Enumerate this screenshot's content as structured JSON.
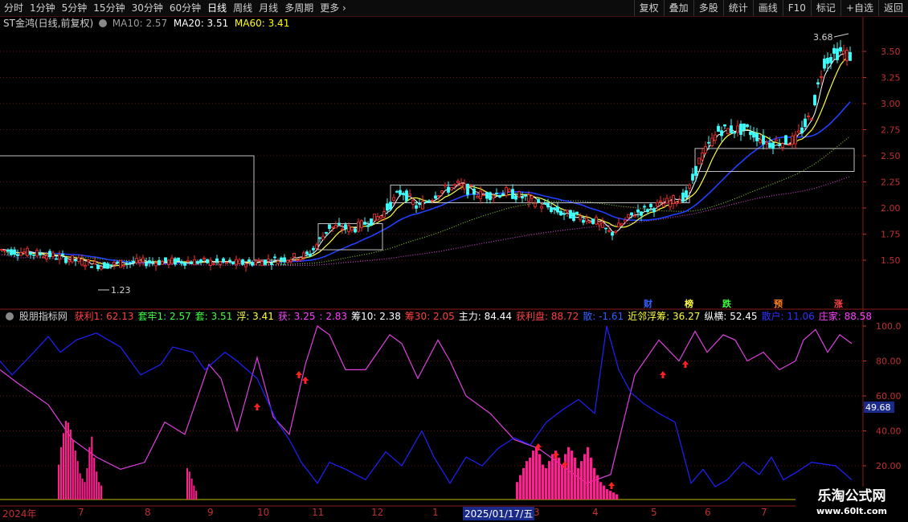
{
  "toolbar": {
    "periods": [
      "分时",
      "1分钟",
      "5分钟",
      "15分钟",
      "30分钟",
      "60分钟",
      "日线",
      "周线",
      "月线",
      "多周期",
      "更多"
    ],
    "active_period": "日线",
    "tools": [
      "复权",
      "叠加",
      "多股",
      "统计",
      "画线",
      "F10",
      "标记",
      "+自选",
      "返回"
    ]
  },
  "main_panel": {
    "stock": "ST金鸿(日线,前复权)",
    "ma10": {
      "label": "MA10: 2.57",
      "color": "#9c9c9c"
    },
    "ma20": {
      "label": "MA20: 3.51",
      "color": "#ffffff"
    },
    "ma60": {
      "label": "MA60: 3.41",
      "color": "#ffff00"
    },
    "high_label": "3.68",
    "low_label": "1.23",
    "yticks": [
      "3.50",
      "3.25",
      "3.00",
      "2.75",
      "2.50",
      "2.25",
      "2.00",
      "1.75",
      "1.50"
    ],
    "markers": [
      {
        "text": "财",
        "color": "#3060ff"
      },
      {
        "text": "榜",
        "color": "#ffff40"
      },
      {
        "text": "跌",
        "color": "#40ff40"
      },
      {
        "text": "预",
        "color": "#ff8020"
      },
      {
        "text": "涨",
        "color": "#ff4040"
      }
    ]
  },
  "indicator_panel": {
    "name": "股朋指标网",
    "items": [
      {
        "text": "获利1: 62.13",
        "color": "#ff4040"
      },
      {
        "text": "套牢1: 2.57",
        "color": "#40ff40"
      },
      {
        "text": "套: 3.51",
        "color": "#40ff40"
      },
      {
        "text": "浮: 3.41",
        "color": "#ffff40"
      },
      {
        "text": "获: 3.25",
        "color": "#ff40ff"
      },
      {
        "text": ": 2.83",
        "color": "#ff40ff"
      },
      {
        "text": "筹10: 2.38",
        "color": "#ffffff"
      },
      {
        "text": "筹30: 2.05",
        "color": "#ff4040"
      },
      {
        "text": "主力: 84.44",
        "color": "#ffffff"
      },
      {
        "text": "获利盘: 88.72",
        "color": "#ff4040"
      },
      {
        "text": "散: -1.61",
        "color": "#3060ff"
      },
      {
        "text": "近邻浮筹: 36.27",
        "color": "#ffff40"
      },
      {
        "text": "纵横: 52.45",
        "color": "#ffffff"
      },
      {
        "text": "散户: 11.06",
        "color": "#3030ff"
      },
      {
        "text": "庄家: 88.58",
        "color": "#ff40ff"
      }
    ],
    "yticks": [
      "100.0",
      "80.00",
      "60.00",
      "40.00",
      "20.00"
    ],
    "current_value": "49.68"
  },
  "date_axis": [
    "2024年",
    "7",
    "8",
    "9",
    "10",
    "11",
    "12",
    "1",
    "2025/01/17/五",
    "3",
    "4",
    "5",
    "6",
    "7"
  ],
  "watermark": {
    "line1": "乐淘公式网",
    "line2": "www.60lt.com"
  }
}
